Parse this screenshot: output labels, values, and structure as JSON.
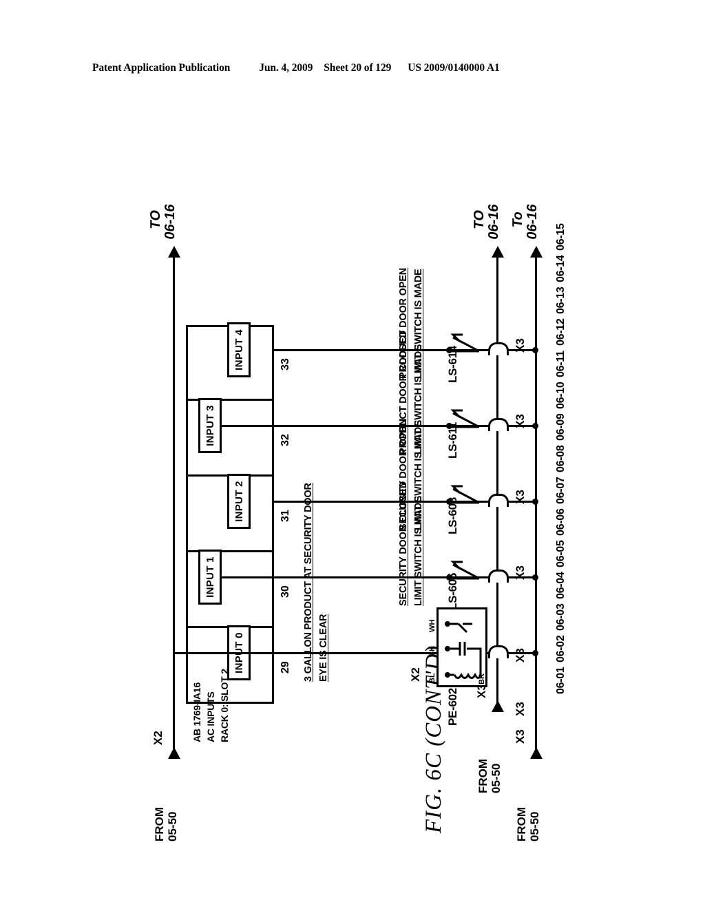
{
  "header": {
    "publication": "Patent Application Publication",
    "date": "Jun. 4, 2009",
    "sheet": "Sheet 20 of 129",
    "patent_number": "US 2009/0140000 A1"
  },
  "figure": {
    "title": "FIG. 6C  (CONT'D)"
  },
  "module": {
    "line1": "AB 1769-IA16",
    "line2": "AC INPUTS",
    "line3": "RACK 0: SLOT 2",
    "inputs": [
      {
        "label": "INPUT 0",
        "terminal": "29"
      },
      {
        "label": "INPUT 1",
        "terminal": "30"
      },
      {
        "label": "INPUT 2",
        "terminal": "31"
      },
      {
        "label": "INPUT 3",
        "terminal": "32"
      },
      {
        "label": "INPUT 4",
        "terminal": "33"
      }
    ]
  },
  "rails": {
    "x2_top": "X2",
    "x2_photoeye": "X2",
    "x3a": "X3A",
    "x3_a": "X3",
    "x3_b": "X3",
    "x3_rungs": [
      "X3",
      "X3",
      "X3",
      "X3",
      "X3"
    ],
    "from_top": {
      "line1": "FROM",
      "line2": "05-50"
    },
    "from_mid": {
      "line1": "FROM",
      "line2": "05-50"
    },
    "from_bottom": {
      "line1": "FROM",
      "line2": "05-50"
    },
    "to_top": {
      "line1": "TO",
      "line2": "06-16"
    },
    "to_mid": {
      "line1": "TO",
      "line2": "06-16"
    },
    "to_bottom": {
      "line1": "To",
      "line2": "06-16"
    }
  },
  "rungs": [
    {
      "device": "PE-602",
      "device_type": "photoeye",
      "wire_labels": {
        "brown": "BR",
        "blue": "BL",
        "black": "BK",
        "white": "WH"
      },
      "rail_label": "X2",
      "description_line1": "3 GALLON PRODUCT AT SECURITY DOOR",
      "description_line2": "EYE IS CLEAR",
      "terminal": "29",
      "input": "INPUT 0"
    },
    {
      "device": "LS-605",
      "device_type": "limit-switch",
      "description_line1": "SECURITY DOOR CLOSED",
      "description_line2": "LIMIT SWITCH IS MADE",
      "terminal": "30",
      "input": "INPUT 1"
    },
    {
      "device": "LS-608",
      "device_type": "limit-switch",
      "description_line1": "SECURITY DOOR OPEN",
      "description_line2": "LIMIT SWITCH IS MADE",
      "terminal": "31",
      "input": "INPUT 2"
    },
    {
      "device": "LS-611",
      "device_type": "limit-switch",
      "description_line1": "PRODUCT DOOR CLOSED",
      "description_line2": "LIMIT SWITCH IS MADE",
      "terminal": "32",
      "input": "INPUT 3"
    },
    {
      "device": "LS-614",
      "device_type": "limit-switch",
      "description_line1": "PRODUCT DOOR OPEN",
      "description_line2": "LIMIT SWITCH IS MADE",
      "terminal": "33",
      "input": "INPUT 4"
    }
  ],
  "row_numbers": [
    "06-01",
    "06-02",
    "06-03",
    "06-04",
    "06-05",
    "06-06",
    "06-07",
    "06-08",
    "06-09",
    "06-10",
    "06-11",
    "06-12",
    "06-13",
    "06-14",
    "06-15"
  ]
}
